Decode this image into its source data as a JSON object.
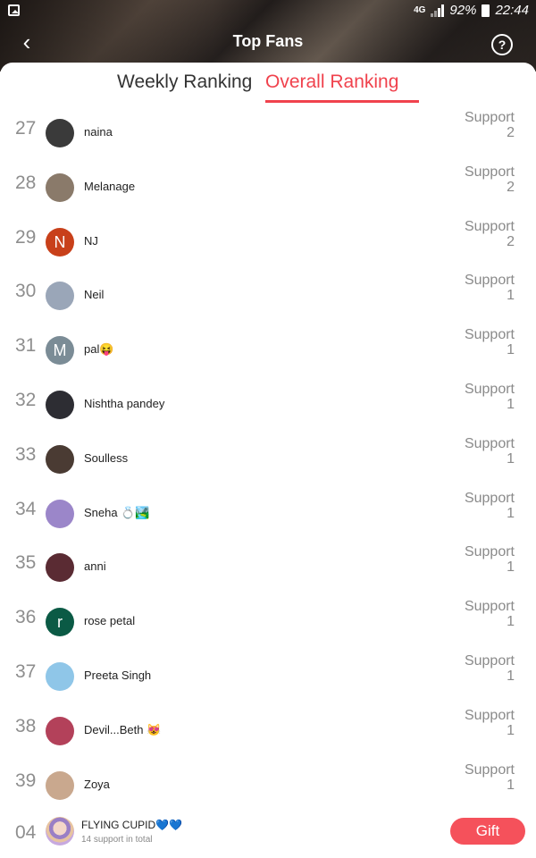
{
  "status_bar": {
    "network": "4G",
    "battery": "92%",
    "time": "22:44"
  },
  "header": {
    "title": "Top Fans"
  },
  "tabs": [
    {
      "label": "Weekly Ranking",
      "active": false
    },
    {
      "label": "Overall Ranking",
      "active": true
    }
  ],
  "support_label": "Support",
  "fans": [
    {
      "rank": "27",
      "name": "naina",
      "support": "2",
      "avatar_bg": "#3a3a3a",
      "avatar_letter": ""
    },
    {
      "rank": "28",
      "name": "Melanage",
      "support": "2",
      "avatar_bg": "#8a7a6a",
      "avatar_letter": ""
    },
    {
      "rank": "29",
      "name": "NJ",
      "support": "2",
      "avatar_bg": "#c8401a",
      "avatar_letter": "N"
    },
    {
      "rank": "30",
      "name": "Neil",
      "support": "1",
      "avatar_bg": "#9aa6b8",
      "avatar_letter": ""
    },
    {
      "rank": "31",
      "name": "pal😝",
      "support": "1",
      "avatar_bg": "#7b8c96",
      "avatar_letter": "M"
    },
    {
      "rank": "32",
      "name": "Nishtha pandey",
      "support": "1",
      "avatar_bg": "#2d2d33",
      "avatar_letter": ""
    },
    {
      "rank": "33",
      "name": "Soulless",
      "support": "1",
      "avatar_bg": "#4a3b33",
      "avatar_letter": ""
    },
    {
      "rank": "34",
      "name": "Sneha 💍🏞️",
      "support": "1",
      "avatar_bg": "#9b86c9",
      "avatar_letter": ""
    },
    {
      "rank": "35",
      "name": "anni",
      "support": "1",
      "avatar_bg": "#5a2b33",
      "avatar_letter": ""
    },
    {
      "rank": "36",
      "name": "rose petal",
      "support": "1",
      "avatar_bg": "#0b5a45",
      "avatar_letter": "r"
    },
    {
      "rank": "37",
      "name": "Preeta Singh",
      "support": "1",
      "avatar_bg": "#8fc6e8",
      "avatar_letter": ""
    },
    {
      "rank": "38",
      "name": "Devil...Beth 😻",
      "support": "1",
      "avatar_bg": "#b3415a",
      "avatar_letter": ""
    },
    {
      "rank": "39",
      "name": "Zoya",
      "support": "1",
      "avatar_bg": "#c9a88e",
      "avatar_letter": ""
    }
  ],
  "me": {
    "rank": "04",
    "name": "FLYING CUPID💙💙",
    "subtitle": "14 support in total"
  },
  "gift_button": "Gift",
  "colors": {
    "accent": "#f0424d",
    "gift": "#f5515b",
    "rank_gray": "#8e8e8e"
  }
}
